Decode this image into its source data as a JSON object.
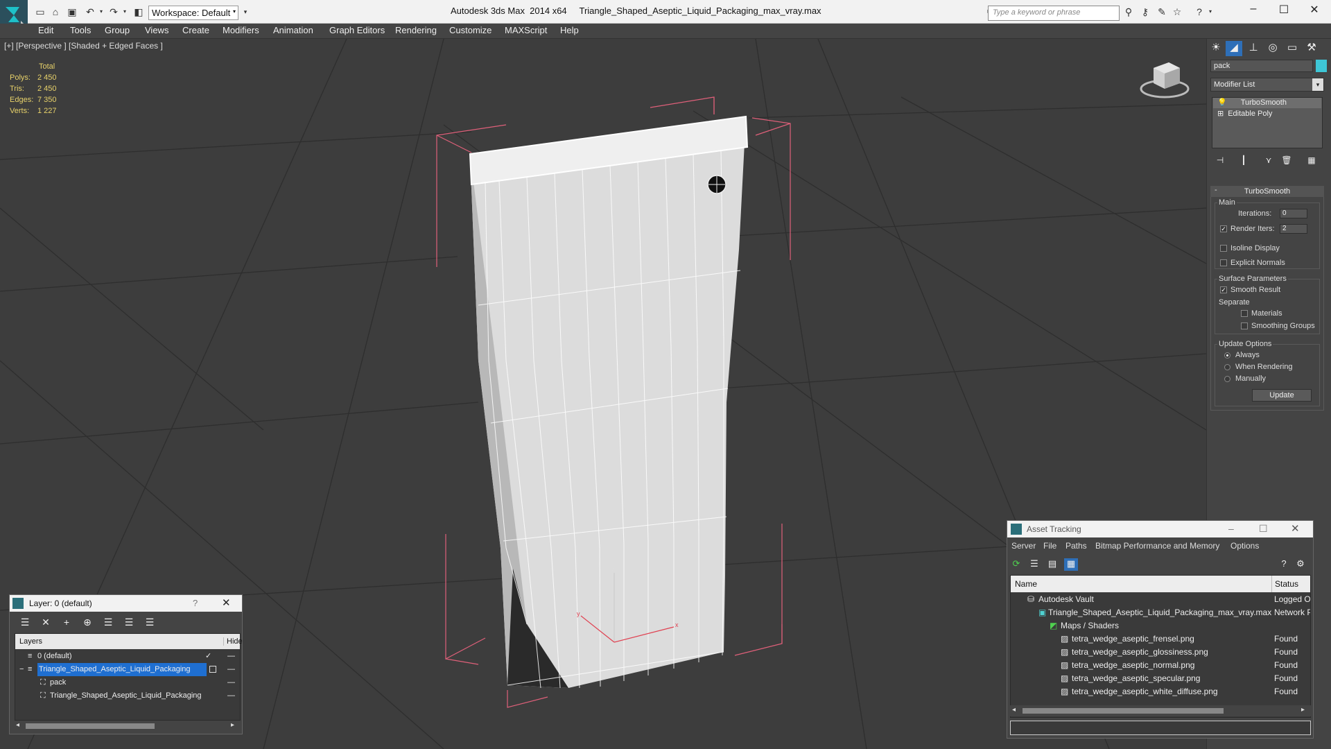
{
  "titlebar": {
    "app": "Autodesk 3ds Max  2014 x64",
    "file": "Triangle_Shaped_Aseptic_Liquid_Packaging_max_vray.max",
    "workspace": "Workspace: Default",
    "search_placeholder": "Type a keyword or phrase"
  },
  "menu": [
    "Edit",
    "Tools",
    "Group",
    "Views",
    "Create",
    "Modifiers",
    "Animation",
    "Graph Editors",
    "Rendering",
    "Customize",
    "MAXScript",
    "Help"
  ],
  "viewport": {
    "label": "[+] [Perspective ] [Shaded + Edged Faces ]",
    "stats": {
      "header": "Total",
      "rows": [
        {
          "label": "Polys:",
          "value": "2 450"
        },
        {
          "label": "Tris:",
          "value": "2 450"
        },
        {
          "label": "Edges:",
          "value": "7 350"
        },
        {
          "label": "Verts:",
          "value": "1 227"
        }
      ]
    },
    "colors": {
      "grid": "#555555",
      "bbox": "#e0607a",
      "stats": "#e8d26a"
    }
  },
  "command_panel": {
    "object_name": "pack",
    "object_color": "#3ec6d6",
    "modifier_list": "Modifier List",
    "stack": [
      "TurboSmooth",
      "Editable Poly"
    ],
    "rollout": {
      "title": "TurboSmooth",
      "main": "Main",
      "iterations_label": "Iterations:",
      "iterations": "0",
      "render_iters_label": "Render Iters:",
      "render_iters": "2",
      "isoline": "Isoline Display",
      "explicit": "Explicit Normals",
      "surface_params": "Surface Parameters",
      "smooth_result": "Smooth Result",
      "separate": "Separate",
      "materials": "Materials",
      "smoothing_groups": "Smoothing Groups",
      "update_options": "Update Options",
      "always": "Always",
      "when_rendering": "When Rendering",
      "manually": "Manually",
      "update": "Update"
    }
  },
  "layer_window": {
    "title": "Layer: 0 (default)",
    "help": "?",
    "col_layers": "Layers",
    "col_hide": "Hide",
    "rows": [
      {
        "name": "0 (default)",
        "selected": false,
        "indent": 0
      },
      {
        "name": "Triangle_Shaped_Aseptic_Liquid_Packaging",
        "selected": true,
        "indent": 0
      },
      {
        "name": "pack",
        "selected": false,
        "indent": 1
      },
      {
        "name": "Triangle_Shaped_Aseptic_Liquid_Packaging",
        "selected": false,
        "indent": 1
      }
    ]
  },
  "asset_tracking": {
    "title": "Asset Tracking",
    "menu": [
      "Server",
      "File",
      "Paths",
      "Bitmap Performance and Memory",
      "Options"
    ],
    "col_name": "Name",
    "col_status": "Status",
    "rows": [
      {
        "name": "Autodesk Vault",
        "status": "Logged O",
        "indent": 0
      },
      {
        "name": "Triangle_Shaped_Aseptic_Liquid_Packaging_max_vray.max",
        "status": "Network P",
        "indent": 1
      },
      {
        "name": "Maps / Shaders",
        "status": "",
        "indent": 2
      },
      {
        "name": "tetra_wedge_aseptic_frensel.png",
        "status": "Found",
        "indent": 3
      },
      {
        "name": "tetra_wedge_aseptic_glossiness.png",
        "status": "Found",
        "indent": 3
      },
      {
        "name": "tetra_wedge_aseptic_normal.png",
        "status": "Found",
        "indent": 3
      },
      {
        "name": "tetra_wedge_aseptic_specular.png",
        "status": "Found",
        "indent": 3
      },
      {
        "name": "tetra_wedge_aseptic_white_diffuse.png",
        "status": "Found",
        "indent": 3
      }
    ]
  }
}
